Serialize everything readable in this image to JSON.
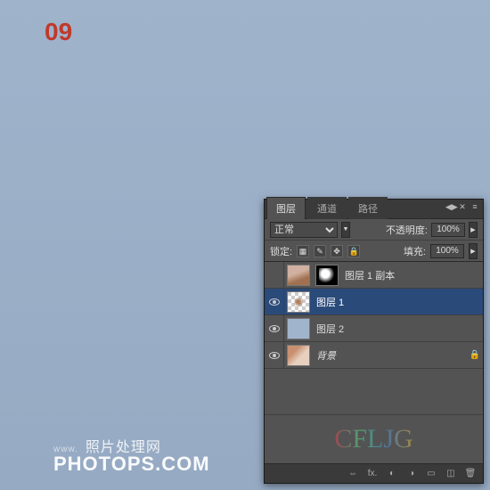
{
  "step_number": "09",
  "watermark": {
    "www": "www.",
    "cn": "照片处理网",
    "domain": "PHOTOPS.COM"
  },
  "panel": {
    "tabs": {
      "layers": "图层",
      "channels": "通道",
      "paths": "路径"
    },
    "blend_mode": "正常",
    "opacity_label": "不透明度:",
    "opacity_value": "100%",
    "lock_label": "锁定:",
    "fill_label": "填充:",
    "fill_value": "100%",
    "layers": [
      {
        "name": "图层 1 副本",
        "visible": false,
        "sel": false,
        "thumb": "hair",
        "mask": true,
        "italic": false,
        "locked": false
      },
      {
        "name": "图层 1",
        "visible": true,
        "sel": true,
        "thumb": "trans",
        "mask": false,
        "italic": false,
        "locked": false
      },
      {
        "name": "图层 2",
        "visible": true,
        "sel": false,
        "thumb": "solid",
        "mask": false,
        "italic": false,
        "locked": false
      },
      {
        "name": "背景",
        "visible": true,
        "sel": false,
        "thumb": "bg",
        "mask": false,
        "italic": true,
        "locked": true
      }
    ],
    "deco_text": "CFLJG",
    "footer_icons": [
      "link-icon",
      "fx-icon",
      "mask-icon",
      "adjustment-icon",
      "group-icon",
      "new-layer-icon",
      "trash-icon"
    ],
    "footer_glyphs": [
      "⇔",
      "fx.",
      "◐",
      "◑",
      "▭",
      "◫",
      "🗑"
    ]
  }
}
